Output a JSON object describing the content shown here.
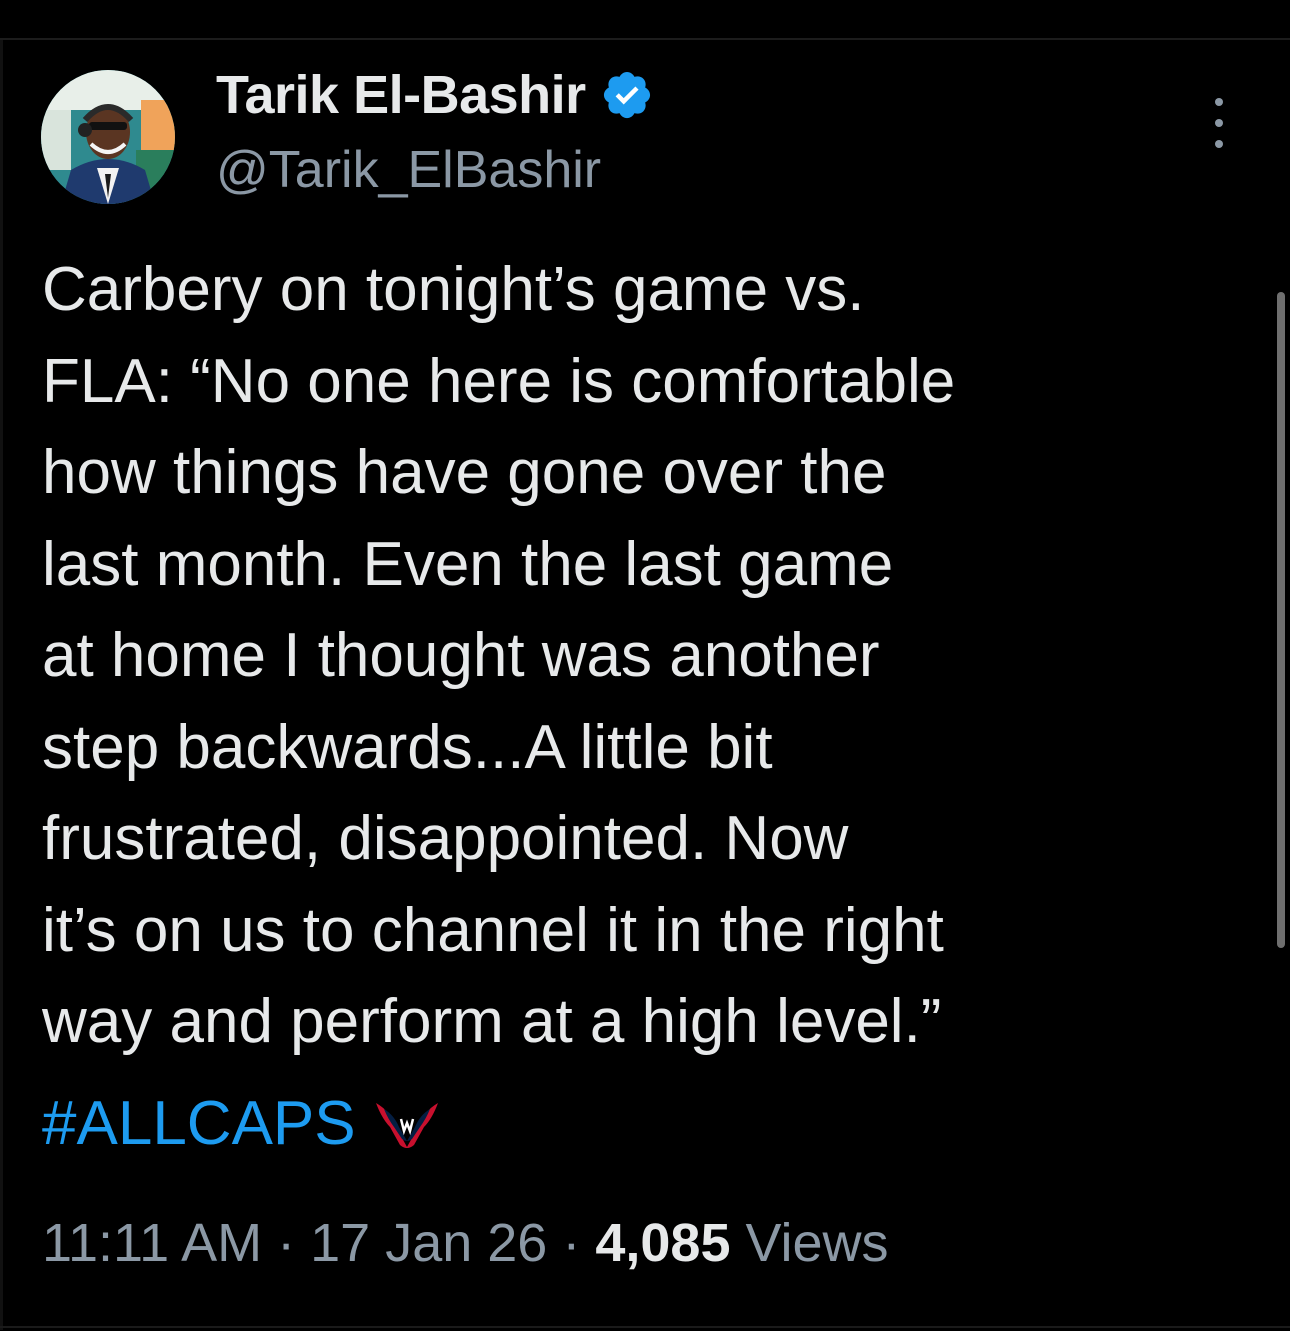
{
  "author": {
    "display_name": "Tarik El-Bashir",
    "handle": "@Tarik_ElBashir",
    "verified": true,
    "avatar_icon": "profile-photo"
  },
  "menu": {
    "icon": "more-vertical-icon"
  },
  "tweet": {
    "lines": [
      "Carbery on tonight’s game vs.",
      "FLA: “No one here is comfortable",
      "how things have gone over the",
      "last month. Even the last game",
      "at home I thought was another",
      "step backwards...A little bit",
      "frustrated, disappointed. Now",
      "it’s on us to channel it in the right",
      "way and perform at a high level.”"
    ],
    "hashtag": "#ALLCAPS",
    "hashtag_emoji": "capitals-logo-icon"
  },
  "meta": {
    "time": "11:11 AM",
    "separator": " · ",
    "date": "17 Jan 26",
    "views_count": "4,085",
    "views_label": " Views"
  },
  "colors": {
    "background": "#000000",
    "text": "#e7e9ea",
    "secondary": "#8b98a5",
    "link": "#1d9bf0",
    "verified": "#1d9bf0"
  }
}
